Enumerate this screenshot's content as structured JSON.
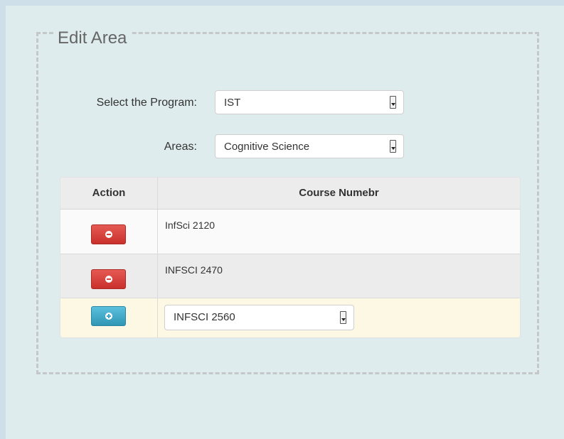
{
  "fieldset": {
    "legend": "Edit Area"
  },
  "form": {
    "program_label": "Select the Program:",
    "program_value": "IST",
    "areas_label": "Areas:",
    "areas_value": "Cognitive Science"
  },
  "table": {
    "headers": [
      "Action",
      "Course Numebr"
    ],
    "rows": [
      {
        "action": "remove",
        "course": "InfSci 2120"
      },
      {
        "action": "remove",
        "course": "INFSCI 2470"
      },
      {
        "action": "add",
        "course": "INFSCI 2560"
      }
    ]
  },
  "colors": {
    "page_bg": "#dfeced",
    "remove_button": "#d9413c",
    "add_button": "#3ba6c9",
    "new_row_bg": "#fcf8e4"
  },
  "icons": {
    "remove": "minus-circle-icon",
    "add": "plus-circle-icon"
  }
}
